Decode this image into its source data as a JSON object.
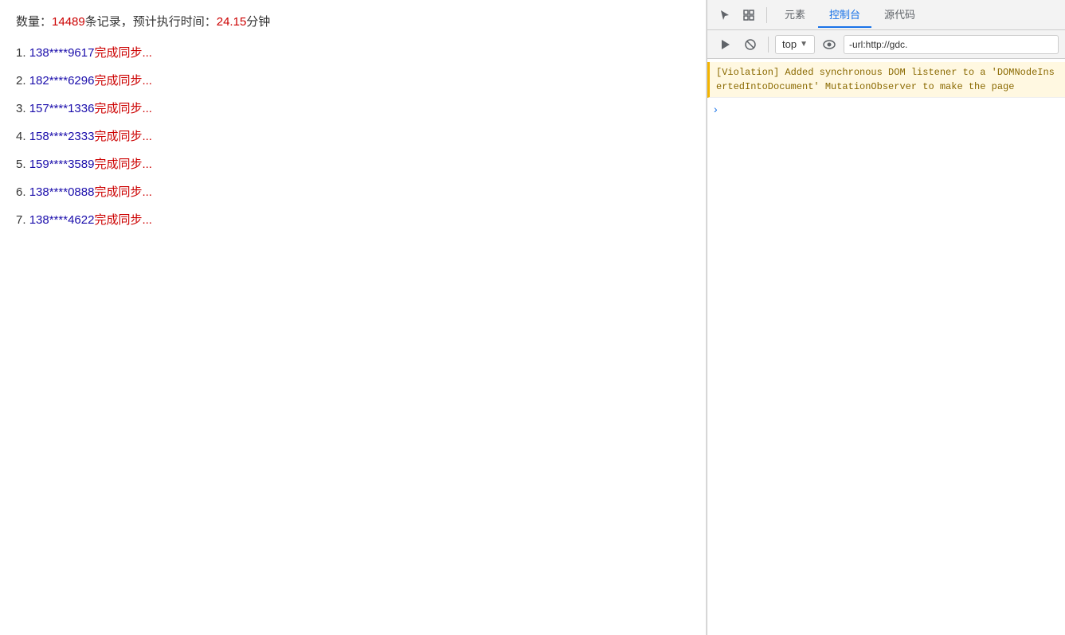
{
  "main": {
    "stats": {
      "prefix": "数量：",
      "count": "14489",
      "unit": "条记录，预计执行时间：",
      "time": "24.15",
      "time_unit": "分钟"
    },
    "sync_items": [
      {
        "number": "1",
        "phone": "138****9617",
        "status": "完成同步..."
      },
      {
        "number": "2",
        "phone": "182****6296",
        "status": "完成同步..."
      },
      {
        "number": "3",
        "phone": "157****1336",
        "status": "完成同步..."
      },
      {
        "number": "4",
        "phone": "158****2333",
        "status": "完成同步..."
      },
      {
        "number": "5",
        "phone": "159****3589",
        "status": "完成同步..."
      },
      {
        "number": "6",
        "phone": "138****0888",
        "status": "完成同步..."
      },
      {
        "number": "7",
        "phone": "138****4622",
        "status": "完成同步..."
      }
    ]
  },
  "devtools": {
    "tabs": [
      {
        "label": "元素",
        "active": false
      },
      {
        "label": "控制台",
        "active": true
      },
      {
        "label": "源代码",
        "active": false
      }
    ],
    "toolbar": {
      "context": "top",
      "filter_placeholder": "-url:http://gdc.",
      "filter_value": "-url:http://gdc."
    },
    "console": {
      "violation_message": "[Violation] Added synchronous DOM listener to a 'DOMNodeInsertedIntoDocument' MutationObserver to make the page"
    }
  }
}
